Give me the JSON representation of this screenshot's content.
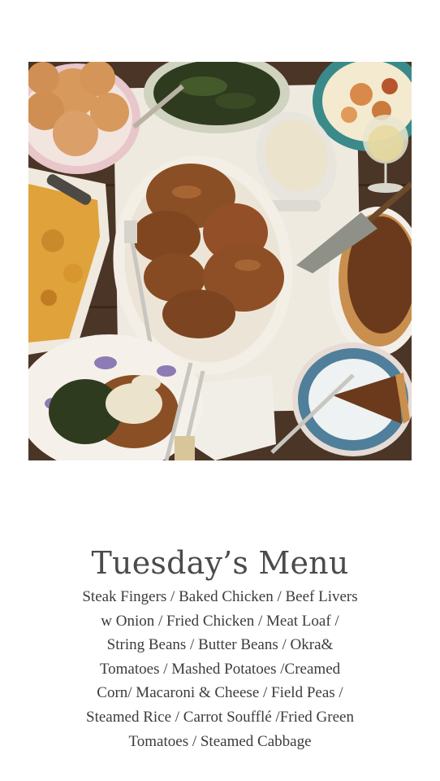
{
  "photo": {
    "icon": "food-photo-icon",
    "colors": {
      "table": "#4a3526",
      "cloth": "#efeadf",
      "plate": "#f3efe6",
      "fried": "#8a4f25",
      "greens": "#2e3b1f",
      "gravy": "#ece3cc",
      "biscuit": "#d89a5c",
      "macaroni": "#e0a23a",
      "pie": "#6b3a1c",
      "teal": "#3a8a8a"
    }
  },
  "title": "Tuesday’s Menu",
  "menu_text": "Steak Fingers / Baked Chicken / Beef Livers w Onion / Fried Chicken / Meat Loaf / String Beans / Butter Beans / Okra& Tomatoes / Mashed Potatoes /Creamed Corn/ Macaroni & Cheese / Field Peas / Steamed Rice / Carrot Soufflé  /Fried Green Tomatoes  / Steamed Cabbage"
}
